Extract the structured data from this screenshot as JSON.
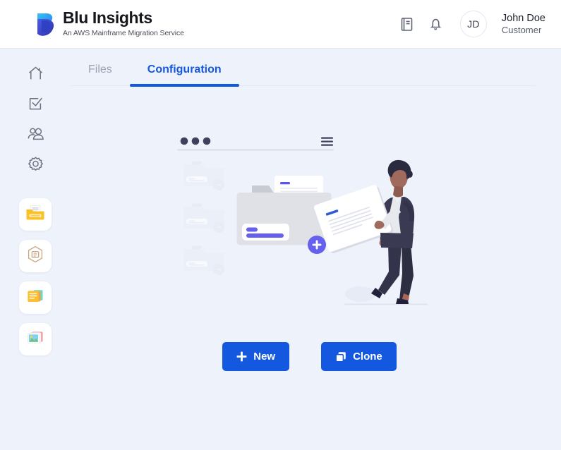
{
  "header": {
    "brand_name": "Blu Insights",
    "brand_tagline": "An AWS Mainframe Migration Service",
    "brand_logo_icon": "blu-insights-b-logo",
    "icons": [
      {
        "name": "docs-book-icon",
        "label": "Documentation"
      },
      {
        "name": "notification-bell-icon",
        "label": "Notifications"
      }
    ],
    "avatar_initials": "JD",
    "user_name": "John Doe",
    "user_role": "Customer"
  },
  "sidebar": {
    "items": [
      {
        "name": "sidebar-item-home",
        "icon": "home-icon",
        "style": "plain",
        "active": false
      },
      {
        "name": "sidebar-item-tasks",
        "icon": "checkbox-check-icon",
        "style": "plain",
        "active": false
      },
      {
        "name": "sidebar-item-users",
        "icon": "users-icon",
        "style": "plain",
        "active": false
      },
      {
        "name": "sidebar-item-settings",
        "icon": "gear-icon",
        "style": "plain",
        "active": false
      },
      {
        "name": "sidebar-item-projects",
        "icon": "folder-documents-icon",
        "style": "tile",
        "active": true
      },
      {
        "name": "sidebar-item-codebase",
        "icon": "hexagon-code-icon",
        "style": "tile",
        "active": false
      },
      {
        "name": "sidebar-item-notes",
        "icon": "sticky-notes-icon",
        "style": "tile",
        "active": false
      },
      {
        "name": "sidebar-item-gallery",
        "icon": "image-gallery-icon",
        "style": "tile",
        "active": false
      }
    ]
  },
  "main": {
    "tabs": [
      {
        "label": "Files",
        "active": false
      },
      {
        "label": "Configuration",
        "active": true
      }
    ],
    "illustration_name": "empty-configuration-illustration",
    "buttons": [
      {
        "label": "New",
        "icon": "plus-icon",
        "name": "new-button"
      },
      {
        "label": "Clone",
        "icon": "copy-clone-icon",
        "name": "clone-button"
      }
    ]
  },
  "colors": {
    "accent_blue": "#1558e0",
    "page_background": "#eef2fb",
    "header_background": "#ffffff",
    "illustration_purple": "#635cf0",
    "active_folder_yellow": "#f9b322",
    "muted_text": "#9aa1b0"
  }
}
